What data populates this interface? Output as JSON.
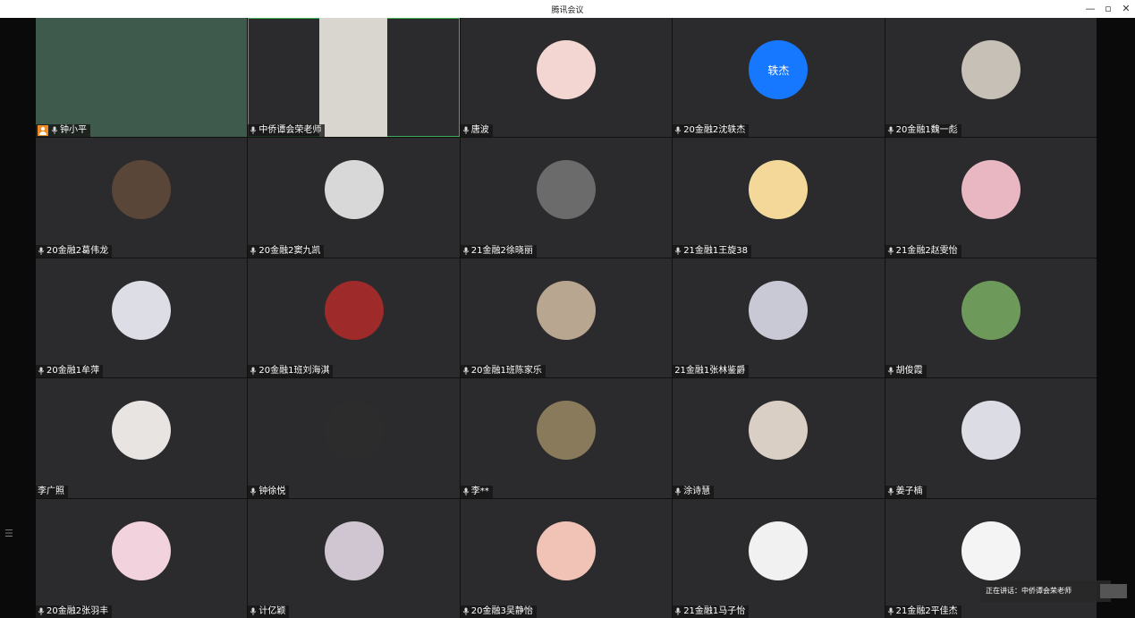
{
  "window": {
    "title": "腾讯会议"
  },
  "speaking": {
    "label": "正在讲话：中侨谭会荣老师"
  },
  "participants": [
    {
      "name": "钟小平",
      "kind": "video",
      "host": true
    },
    {
      "name": "中侨谭会荣老师",
      "kind": "video"
    },
    {
      "name": "唐波",
      "kind": "avatar",
      "color": "#f3d6d2"
    },
    {
      "name": "20金融2沈轶杰",
      "kind": "text-avatar",
      "avatar_text": "轶杰",
      "color": "#1677ff"
    },
    {
      "name": "20金融1魏一彪",
      "kind": "avatar",
      "color": "#c7c0b6"
    },
    {
      "name": "20金融2葛伟龙",
      "kind": "avatar",
      "color": "#5a4638"
    },
    {
      "name": "20金融2窦九凯",
      "kind": "avatar",
      "color": "#d8d8d8"
    },
    {
      "name": "21金融2徐晓丽",
      "kind": "avatar",
      "color": "#6b6b6b"
    },
    {
      "name": "21金融1王旋38",
      "kind": "avatar",
      "color": "#f4d89a"
    },
    {
      "name": "21金融2赵雯怡",
      "kind": "avatar",
      "color": "#e8b7c2"
    },
    {
      "name": "20金融1牟萍",
      "kind": "avatar",
      "color": "#dcdde5"
    },
    {
      "name": "20金融1班刘海淇",
      "kind": "avatar",
      "color": "#9f2a2a"
    },
    {
      "name": "20金融1班陈家乐",
      "kind": "avatar",
      "color": "#b9a690"
    },
    {
      "name": "21金融1张林鉴爵",
      "kind": "avatar",
      "color": "#c9c9d6",
      "muted_icon": false
    },
    {
      "name": "胡俊霞",
      "kind": "avatar",
      "color": "#6d9a5a"
    },
    {
      "name": "李广照",
      "kind": "avatar",
      "color": "#e7e4e2",
      "muted_icon": false
    },
    {
      "name": "钟徐悦",
      "kind": "avatar",
      "color": "#2c2c2c"
    },
    {
      "name": "李**",
      "kind": "avatar",
      "color": "#8a7a5c"
    },
    {
      "name": "涂诗慧",
      "kind": "avatar",
      "color": "#d9cfc4"
    },
    {
      "name": "姜子楠",
      "kind": "avatar",
      "color": "#dcdce4"
    },
    {
      "name": "20金融2张羽丰",
      "kind": "avatar",
      "color": "#f2d2dc"
    },
    {
      "name": "计亿颖",
      "kind": "avatar",
      "color": "#cfc6d2"
    },
    {
      "name": "20金融3吴静怡",
      "kind": "avatar",
      "color": "#f0c3b6"
    },
    {
      "name": "21金融1马子怡",
      "kind": "avatar",
      "color": "#f1f1f1"
    },
    {
      "name": "21金融2平佳杰",
      "kind": "avatar",
      "color": "#f4f4f4"
    }
  ]
}
